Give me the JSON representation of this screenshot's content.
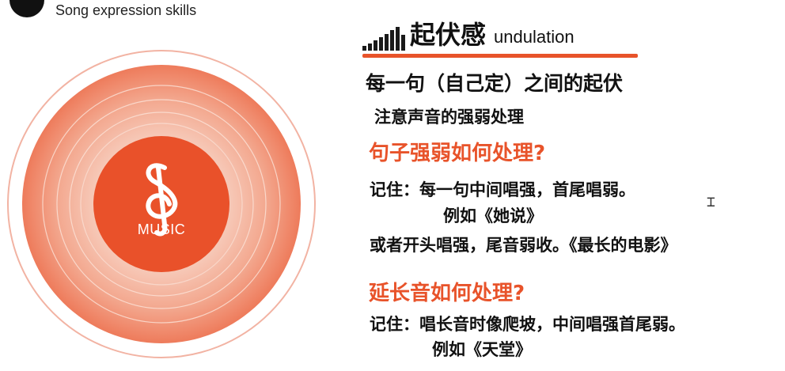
{
  "header": {
    "subtitle": "Song expression skills"
  },
  "disc": {
    "label": "MUSIC",
    "icon": "treble-clef-icon",
    "colors": {
      "core": "#e9512a",
      "outer_ring": "#f0a896",
      "inner_glow": "#f6c6b4"
    }
  },
  "slide": {
    "title_cn": "起伏感",
    "title_en": "undulation",
    "title_icon": "volume-bars-icon",
    "main_point": "每一句（自己定）之间的起伏",
    "sub_point": "注意声音的强弱处理",
    "question_1": "句子强弱如何处理?",
    "q1_line_1": "记住：每一句中间唱强，首尾唱弱。",
    "q1_example": "例如《她说》",
    "q1_line_2": "或者开头唱强，尾音弱收。《最长的电影》",
    "question_2": "延长音如何处理?",
    "q2_line_1": "记住：唱长音时像爬坡，中间唱强首尾弱。",
    "q2_example": "例如《天堂》",
    "accent_color": "#e8532a"
  }
}
